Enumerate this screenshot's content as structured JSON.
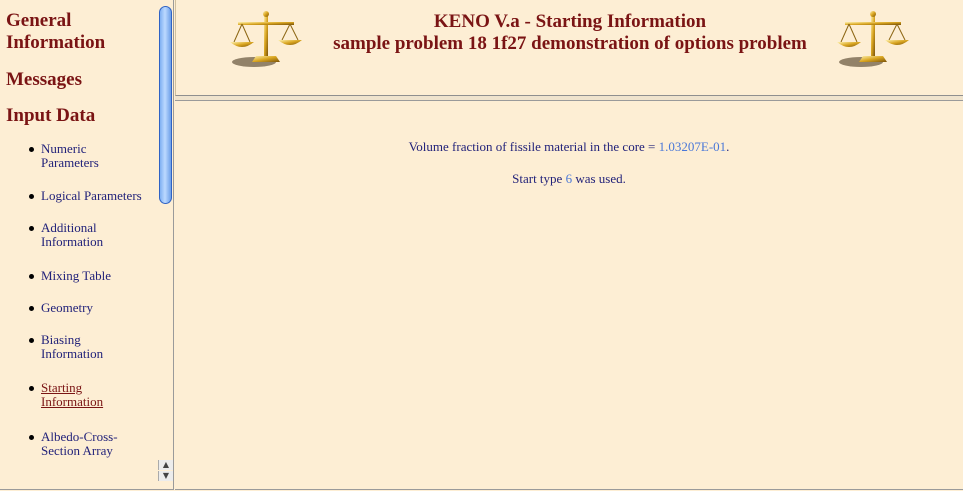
{
  "nav": {
    "general": "General\nInformation",
    "general_line1": "General",
    "general_line2": "Information",
    "messages": "Messages",
    "input_data": "Input Data",
    "items": [
      {
        "line1": "Numeric",
        "line2": "Parameters"
      },
      {
        "line1": "Logical Parameters",
        "line2": ""
      },
      {
        "line1": "Additional",
        "line2": "Information"
      },
      {
        "line1": "Mixing Table",
        "line2": ""
      },
      {
        "line1": "Geometry",
        "line2": ""
      },
      {
        "line1": "Biasing",
        "line2": "Information"
      },
      {
        "line1": "Starting",
        "line2": "Information"
      },
      {
        "line1": "Albedo-Cross-",
        "line2": "Section Array"
      }
    ],
    "active_index": 6,
    "scroll_up_icon": "▲",
    "scroll_down_icon": "▼"
  },
  "header": {
    "title": "KENO V.a - Starting Information",
    "subtitle": "sample problem 18 1f27 demonstration of options problem",
    "icon": "balance-scale-icon"
  },
  "main": {
    "vf_label": "Volume fraction of fissile material in the core = ",
    "vf_value": "1.03207E-01",
    "vf_suffix": ".",
    "st_prefix": "Start type ",
    "st_value": "6",
    "st_suffix": " was used."
  },
  "colors": {
    "background": "#fdeed4",
    "heading": "#7a1414",
    "link": "#22227a",
    "value": "#4a78d8"
  }
}
